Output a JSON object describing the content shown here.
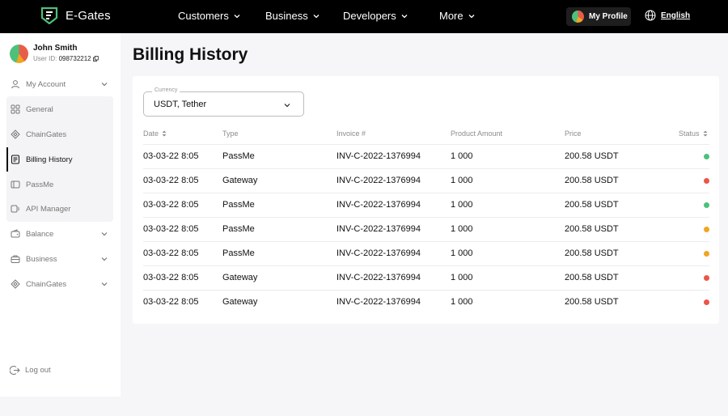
{
  "brand": {
    "name": "E-Gates"
  },
  "nav": {
    "items": [
      {
        "label": "Customers"
      },
      {
        "label": "Business"
      },
      {
        "label": "Developers"
      },
      {
        "label": "More"
      }
    ],
    "profile_label": "My Profile",
    "language_label": "English"
  },
  "user": {
    "name": "John Smith",
    "id_label": "User ID:",
    "id_value": "098732212"
  },
  "sidebar": {
    "items": [
      {
        "label": "My Account",
        "icon": "user-icon"
      },
      {
        "label": "General",
        "icon": "grid-icon"
      },
      {
        "label": "ChainGates",
        "icon": "diamond-icon"
      },
      {
        "label": "Billing History",
        "icon": "receipt-icon"
      },
      {
        "label": "PassMe",
        "icon": "card-icon"
      },
      {
        "label": "API Manager",
        "icon": "api-icon"
      },
      {
        "label": "Balance",
        "icon": "wallet-icon"
      },
      {
        "label": "Business",
        "icon": "briefcase-icon"
      },
      {
        "label": "ChainGates",
        "icon": "diamond-icon"
      }
    ],
    "logout_label": "Log out"
  },
  "page": {
    "title": "Billing History"
  },
  "filter": {
    "label": "Currency",
    "value": "USDT, Tether"
  },
  "table": {
    "headers": {
      "date": "Date",
      "type": "Type",
      "invoice": "Invoice #",
      "amount": "Product Amount",
      "price": "Price",
      "status": "Status"
    },
    "rows": [
      {
        "date": "03-03-22 8:05",
        "type": "PassMe",
        "invoice": "INV-C-2022-1376994",
        "amount": "1 000",
        "price": "200.58 USDT",
        "status_color": "#4ec07a"
      },
      {
        "date": "03-03-22 8:05",
        "type": "Gateway",
        "invoice": "INV-C-2022-1376994",
        "amount": "1 000",
        "price": "200.58 USDT",
        "status_color": "#ec5549"
      },
      {
        "date": "03-03-22 8:05",
        "type": "PassMe",
        "invoice": "INV-C-2022-1376994",
        "amount": "1 000",
        "price": "200.58 USDT",
        "status_color": "#4ec07a"
      },
      {
        "date": "03-03-22 8:05",
        "type": "PassMe",
        "invoice": "INV-C-2022-1376994",
        "amount": "1 000",
        "price": "200.58 USDT",
        "status_color": "#f2a51f"
      },
      {
        "date": "03-03-22 8:05",
        "type": "PassMe",
        "invoice": "INV-C-2022-1376994",
        "amount": "1 000",
        "price": "200.58 USDT",
        "status_color": "#f2a51f"
      },
      {
        "date": "03-03-22 8:05",
        "type": "Gateway",
        "invoice": "INV-C-2022-1376994",
        "amount": "1 000",
        "price": "200.58 USDT",
        "status_color": "#ec5549"
      },
      {
        "date": "03-03-22 8:05",
        "type": "Gateway",
        "invoice": "INV-C-2022-1376994",
        "amount": "1 000",
        "price": "200.58 USDT",
        "status_color": "#ec5549"
      }
    ]
  }
}
